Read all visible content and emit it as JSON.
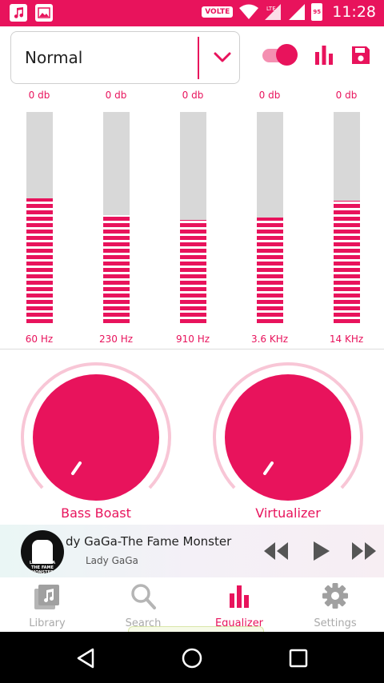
{
  "status_bar": {
    "volte": "VOLTE",
    "battery": "95",
    "time": "11:28"
  },
  "preset": {
    "value": "Normal"
  },
  "colors": {
    "accent": "#e8135c",
    "accent_light": "#f48fb1",
    "track_gray": "#d8d8d8",
    "nav_inactive": "#aaaaaa"
  },
  "equalizer": {
    "enabled": true,
    "bands": [
      {
        "db": "0 db",
        "freq": "60 Hz",
        "level": 0.59
      },
      {
        "db": "0 db",
        "freq": "230 Hz",
        "level": 0.51
      },
      {
        "db": "0 db",
        "freq": "910 Hz",
        "level": 0.49
      },
      {
        "db": "0 db",
        "freq": "3.6 KHz",
        "level": 0.5
      },
      {
        "db": "0 db",
        "freq": "14 KHz",
        "level": 0.58
      }
    ]
  },
  "knobs": {
    "bass_boost": {
      "label": "Bass Boast",
      "level": 0.0
    },
    "virtualizer": {
      "label": "Virtualizer",
      "level": 0.0
    }
  },
  "player": {
    "album_text": "LADY GAGA THE FAME MONSTER",
    "title": "dy GaGa-The Fame Monster",
    "artist": "Lady GaGa",
    "icons": [
      "rewind-icon",
      "play-icon",
      "fast-forward-icon"
    ]
  },
  "nav": {
    "items": [
      {
        "label": "Library",
        "icon": "library-icon",
        "active": false
      },
      {
        "label": "Search",
        "icon": "search-icon",
        "active": false
      },
      {
        "label": "Equalizer",
        "icon": "equalizer-icon",
        "active": true
      },
      {
        "label": "Settings",
        "icon": "settings-icon",
        "active": false
      }
    ]
  },
  "system_nav": {
    "icons": [
      "back-icon",
      "home-icon",
      "recents-icon"
    ]
  }
}
